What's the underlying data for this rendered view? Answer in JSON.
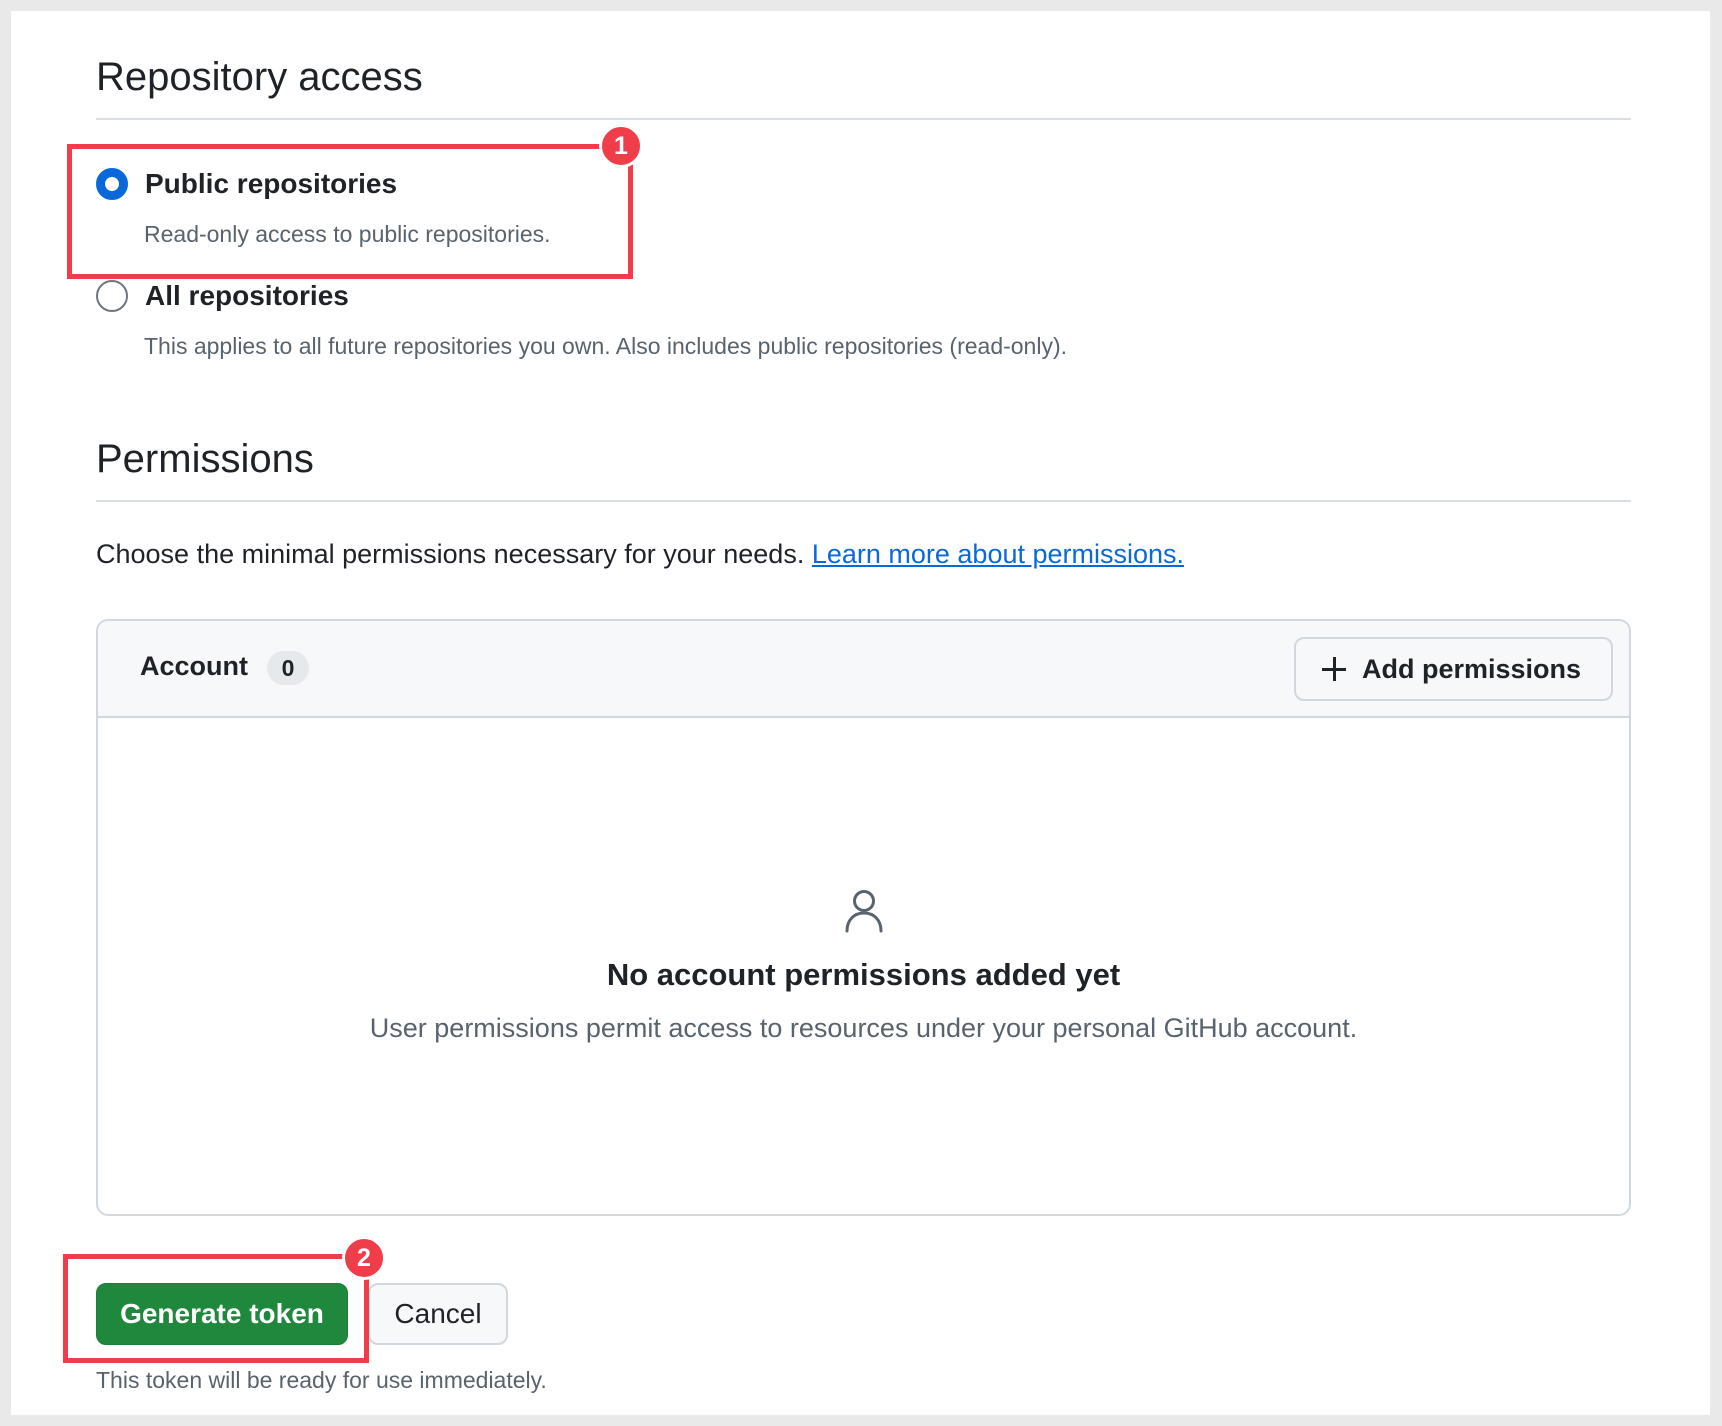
{
  "repository_access": {
    "title": "Repository access",
    "options": [
      {
        "label": "Public repositories",
        "description": "Read-only access to public repositories.",
        "selected": true
      },
      {
        "label": "All repositories",
        "description": "This applies to all future repositories you own. Also includes public repositories (read-only).",
        "selected": false
      }
    ]
  },
  "permissions": {
    "title": "Permissions",
    "intro_text": "Choose the minimal permissions necessary for your needs.",
    "learn_more_link": "Learn more about permissions.",
    "account_section": {
      "title": "Account",
      "count": "0",
      "add_button_label": "Add permissions",
      "add_icon": "plus-icon",
      "empty_icon": "person-icon",
      "empty_title": "No account permissions added yet",
      "empty_description": "User permissions permit access to resources under your personal GitHub account."
    }
  },
  "actions": {
    "generate_label": "Generate token",
    "cancel_label": "Cancel",
    "footnote": "This token will be ready for use immediately."
  },
  "annotations": {
    "step_1": "1",
    "step_2": "2",
    "highlight_color": "#ef3e4a"
  },
  "colors": {
    "accent_blue": "#0969da",
    "primary_green": "#1f883d",
    "border": "#d0d7de"
  }
}
